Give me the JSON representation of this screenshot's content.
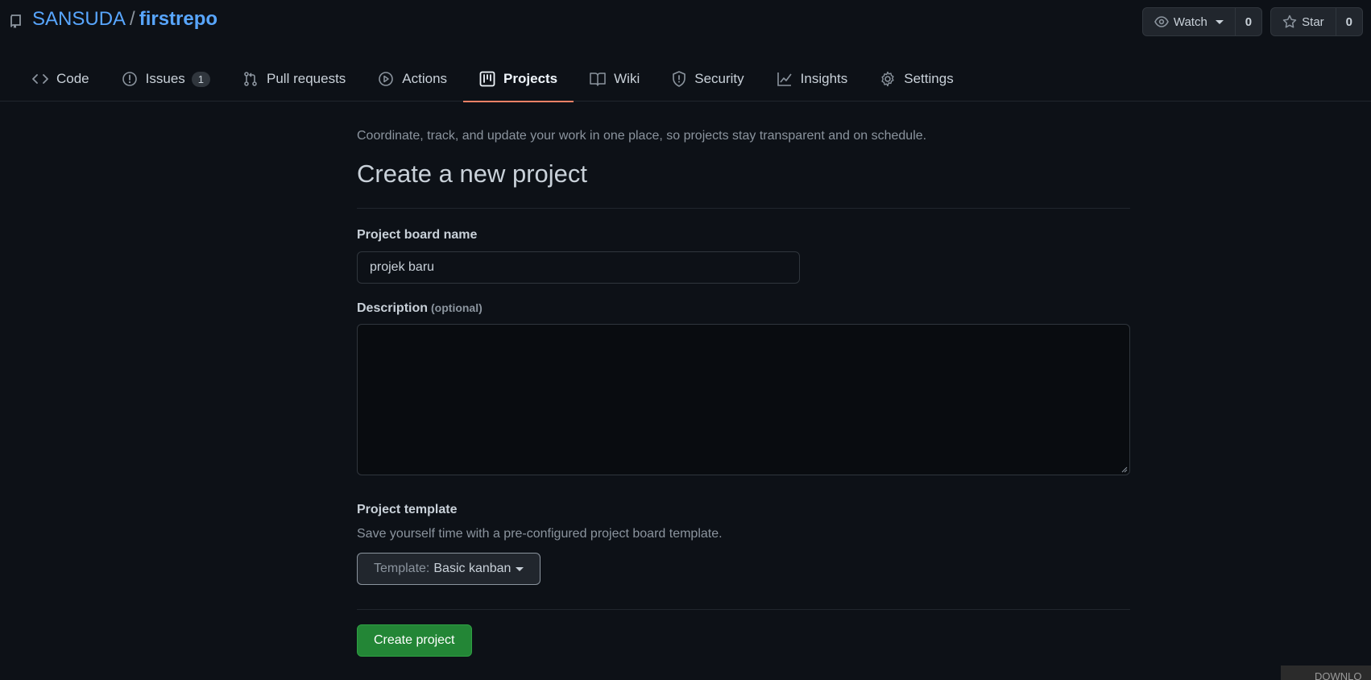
{
  "repo": {
    "owner": "SANSUDA",
    "separator": "/",
    "name": "firstrepo",
    "icon": "repo-icon"
  },
  "actions": {
    "watch_label": "Watch",
    "watch_count": "0",
    "star_label": "Star",
    "star_count": "0"
  },
  "tabs": [
    {
      "label": "Code",
      "icon": "code-icon"
    },
    {
      "label": "Issues",
      "icon": "issue-icon",
      "count": "1"
    },
    {
      "label": "Pull requests",
      "icon": "pull-request-icon"
    },
    {
      "label": "Actions",
      "icon": "play-icon"
    },
    {
      "label": "Projects",
      "icon": "project-icon",
      "active": true
    },
    {
      "label": "Wiki",
      "icon": "book-icon"
    },
    {
      "label": "Security",
      "icon": "shield-icon"
    },
    {
      "label": "Insights",
      "icon": "graph-icon"
    },
    {
      "label": "Settings",
      "icon": "gear-icon"
    }
  ],
  "form": {
    "lead": "Coordinate, track, and update your work in one place, so projects stay transparent and on schedule.",
    "title": "Create a new project",
    "name_label": "Project board name",
    "name_value": "projek baru",
    "description_label": "Description",
    "description_optional": "(optional)",
    "description_value": "",
    "template_label": "Project template",
    "template_note": "Save yourself time with a pre-configured project board template.",
    "template_prefix": "Template:",
    "template_value": "Basic kanban",
    "submit_label": "Create project"
  },
  "download_bar": {
    "label": "DOWNLO"
  },
  "colors": {
    "background": "#0d1117",
    "link": "#58a6ff",
    "active_tab_underline": "#f78166",
    "primary_button": "#238636"
  }
}
